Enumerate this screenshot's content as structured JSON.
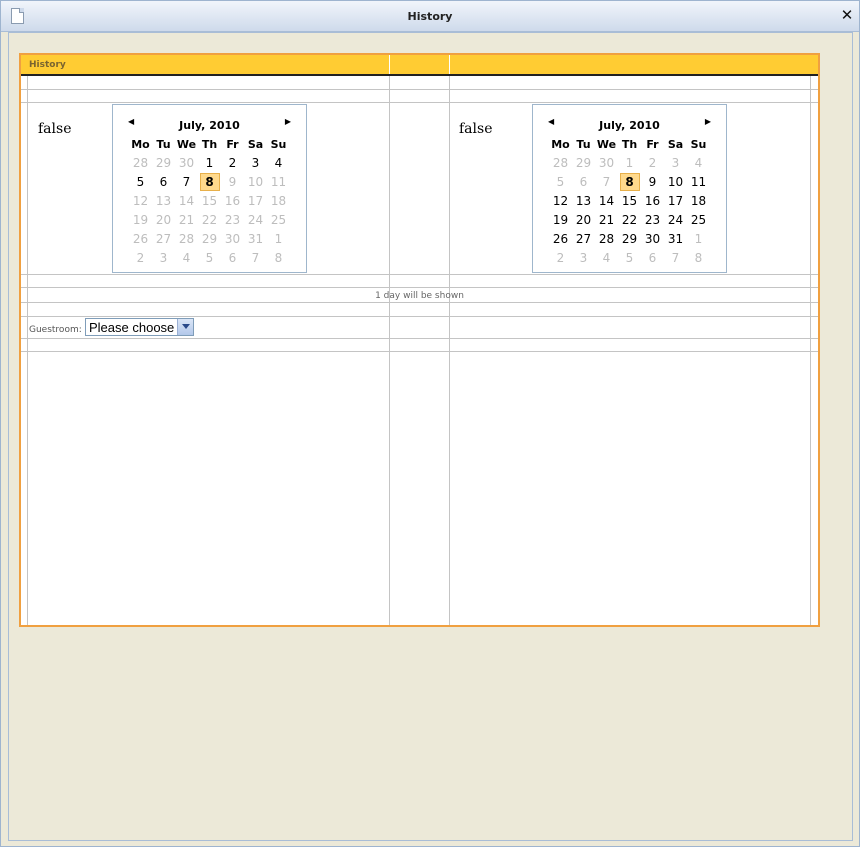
{
  "window": {
    "title": "History",
    "icon": "document-icon",
    "close_icon": "close-icon"
  },
  "panel": {
    "header_title": "History",
    "left_value": "false",
    "right_value": "false",
    "days_info": "1 day will be shown",
    "guestroom_label": "Guestroom:",
    "guestroom_select": "Please choose"
  },
  "colors": {
    "header": "#ffcc33",
    "panel_border": "#f0a040",
    "today_highlight": "#ffd98c"
  },
  "calendar_left": {
    "title": "July, 2010",
    "weekdays": [
      "Mo",
      "Tu",
      "We",
      "Th",
      "Fr",
      "Sa",
      "Su"
    ],
    "weeks": [
      [
        {
          "d": "28",
          "o": 1
        },
        {
          "d": "29",
          "o": 1
        },
        {
          "d": "30",
          "o": 1
        },
        {
          "d": "1"
        },
        {
          "d": "2"
        },
        {
          "d": "3"
        },
        {
          "d": "4"
        }
      ],
      [
        {
          "d": "5"
        },
        {
          "d": "6"
        },
        {
          "d": "7"
        },
        {
          "d": "8",
          "t": 1
        },
        {
          "d": "9",
          "o": 1
        },
        {
          "d": "10",
          "o": 1
        },
        {
          "d": "11",
          "o": 1
        }
      ],
      [
        {
          "d": "12",
          "o": 1
        },
        {
          "d": "13",
          "o": 1
        },
        {
          "d": "14",
          "o": 1
        },
        {
          "d": "15",
          "o": 1
        },
        {
          "d": "16",
          "o": 1
        },
        {
          "d": "17",
          "o": 1
        },
        {
          "d": "18",
          "o": 1
        }
      ],
      [
        {
          "d": "19",
          "o": 1
        },
        {
          "d": "20",
          "o": 1
        },
        {
          "d": "21",
          "o": 1
        },
        {
          "d": "22",
          "o": 1
        },
        {
          "d": "23",
          "o": 1
        },
        {
          "d": "24",
          "o": 1
        },
        {
          "d": "25",
          "o": 1
        }
      ],
      [
        {
          "d": "26",
          "o": 1
        },
        {
          "d": "27",
          "o": 1
        },
        {
          "d": "28",
          "o": 1
        },
        {
          "d": "29",
          "o": 1
        },
        {
          "d": "30",
          "o": 1
        },
        {
          "d": "31",
          "o": 1
        },
        {
          "d": "1",
          "o": 1
        }
      ],
      [
        {
          "d": "2",
          "o": 1
        },
        {
          "d": "3",
          "o": 1
        },
        {
          "d": "4",
          "o": 1
        },
        {
          "d": "5",
          "o": 1
        },
        {
          "d": "6",
          "o": 1
        },
        {
          "d": "7",
          "o": 1
        },
        {
          "d": "8",
          "o": 1
        }
      ]
    ]
  },
  "calendar_right": {
    "title": "July, 2010",
    "weekdays": [
      "Mo",
      "Tu",
      "We",
      "Th",
      "Fr",
      "Sa",
      "Su"
    ],
    "weeks": [
      [
        {
          "d": "28",
          "o": 1
        },
        {
          "d": "29",
          "o": 1
        },
        {
          "d": "30",
          "o": 1
        },
        {
          "d": "1",
          "o": 1
        },
        {
          "d": "2",
          "o": 1
        },
        {
          "d": "3",
          "o": 1
        },
        {
          "d": "4",
          "o": 1
        }
      ],
      [
        {
          "d": "5",
          "o": 1
        },
        {
          "d": "6",
          "o": 1
        },
        {
          "d": "7",
          "o": 1
        },
        {
          "d": "8",
          "t": 1
        },
        {
          "d": "9"
        },
        {
          "d": "10"
        },
        {
          "d": "11"
        }
      ],
      [
        {
          "d": "12"
        },
        {
          "d": "13"
        },
        {
          "d": "14"
        },
        {
          "d": "15"
        },
        {
          "d": "16"
        },
        {
          "d": "17"
        },
        {
          "d": "18"
        }
      ],
      [
        {
          "d": "19"
        },
        {
          "d": "20"
        },
        {
          "d": "21"
        },
        {
          "d": "22"
        },
        {
          "d": "23"
        },
        {
          "d": "24"
        },
        {
          "d": "25"
        }
      ],
      [
        {
          "d": "26"
        },
        {
          "d": "27"
        },
        {
          "d": "28"
        },
        {
          "d": "29"
        },
        {
          "d": "30"
        },
        {
          "d": "31"
        },
        {
          "d": "1",
          "o": 1
        }
      ],
      [
        {
          "d": "2",
          "o": 1
        },
        {
          "d": "3",
          "o": 1
        },
        {
          "d": "4",
          "o": 1
        },
        {
          "d": "5",
          "o": 1
        },
        {
          "d": "6",
          "o": 1
        },
        {
          "d": "7",
          "o": 1
        },
        {
          "d": "8",
          "o": 1
        }
      ]
    ]
  }
}
